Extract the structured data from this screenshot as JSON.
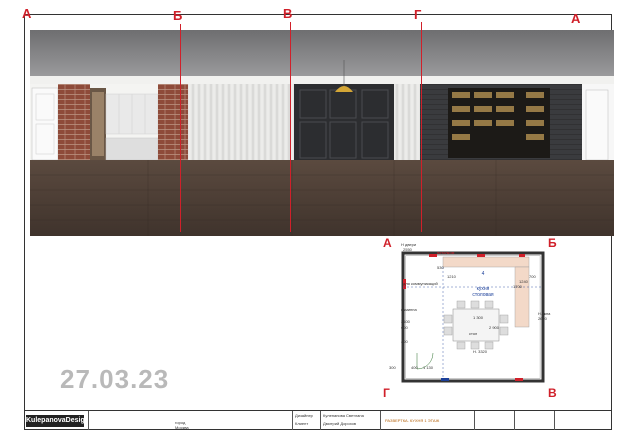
{
  "axes_top": [
    "А",
    "Б",
    "В",
    "Г",
    "А"
  ],
  "date": "27.03.23",
  "plan": {
    "axes": {
      "a": "А",
      "b": "Б",
      "g": "Г",
      "v": "В"
    },
    "room_number": "4",
    "room_name_1": "кухня",
    "room_name_2": "столовая",
    "labels": {
      "door_height": "Н двери",
      "door_height_val": "2550",
      "ceiling": "потолком",
      "dim_1210": "1210",
      "dim_530": "530",
      "dim_1240": "1240",
      "dim_1700": "1700",
      "dim_700": "700",
      "communications": "для коммуникаций",
      "fireplace": "каминна",
      "table": "стол",
      "dim_1300": "1 300",
      "dim_2900": "2 900",
      "dim_3320": "Н. 3320",
      "dim_400a": "400",
      "dim_400b": "400",
      "dim_300": "300",
      "dim_1130": "1 130",
      "dim_2600": "2600",
      "dim_600": "600",
      "height_right": "Н.окна",
      "dim_2600b": "2600"
    }
  },
  "title_block": {
    "logo": "KulepanovaDesign",
    "address": "город Москва",
    "role_designer": "Дизайнер",
    "designer_name": "Кулепанова Светлана",
    "role_client": "Клиент",
    "client_name": "Дмитрий Дорохов",
    "sheet_title": "РАЗВЕРТКА. КУХНЯ 1 ЭТАЖ",
    "col_a": "",
    "col_b": ""
  }
}
